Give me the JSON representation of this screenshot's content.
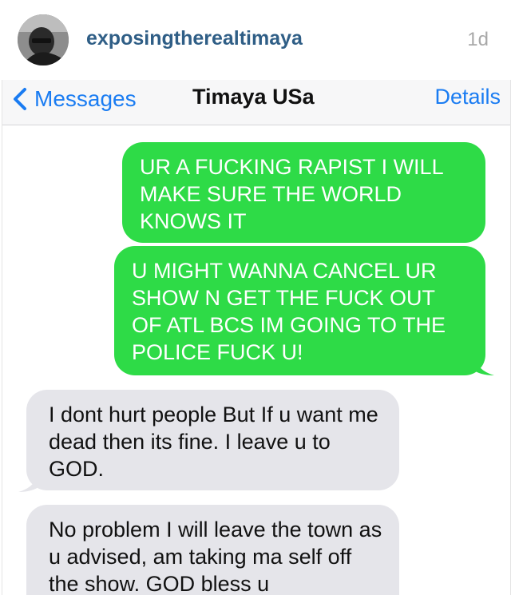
{
  "post": {
    "username": "exposingtherealtimaya",
    "age": "1d"
  },
  "navbar": {
    "back_label": "Messages",
    "title": "Timaya USa",
    "details_label": "Details"
  },
  "messages": [
    {
      "direction": "sent",
      "text": "UR A FUCKING RAPIST I WILL MAKE SURE THE WORLD KNOWS IT"
    },
    {
      "direction": "sent",
      "text": "U MIGHT WANNA CANCEL UR SHOW N GET THE FUCK OUT OF ATL BCS IM GOING TO THE POLICE FUCK U!"
    },
    {
      "direction": "received",
      "text": "I dont  hurt people But If u want me dead then its fine. I  leave u to GOD."
    },
    {
      "direction": "received",
      "text": "No problem I will leave the town as u advised, am taking ma self off the show. GOD bless u"
    }
  ],
  "colors": {
    "sent_bubble": "#2edb47",
    "received_bubble": "#e5e5ea",
    "ios_blue": "#1a7cf2",
    "username": "#2f5e86"
  }
}
